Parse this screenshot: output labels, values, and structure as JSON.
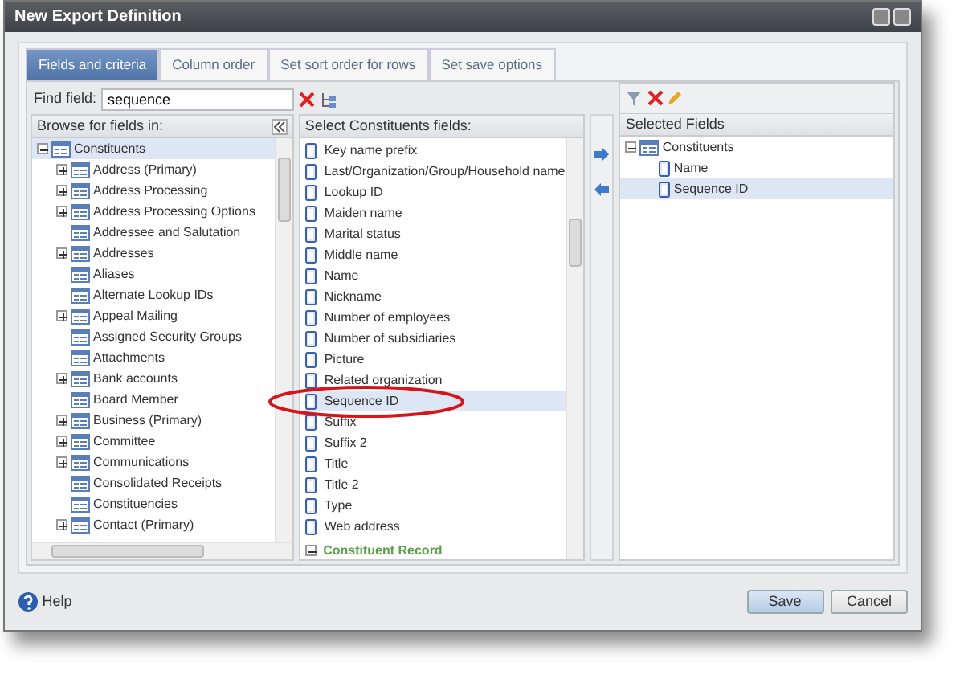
{
  "window": {
    "title": "New Export Definition"
  },
  "tabs": [
    {
      "label": "Fields and criteria",
      "selected": true
    },
    {
      "label": "Column order",
      "selected": false
    },
    {
      "label": "Set sort order for rows",
      "selected": false
    },
    {
      "label": "Set save options",
      "selected": false
    }
  ],
  "find": {
    "label": "Find field:",
    "value": "sequence"
  },
  "browse": {
    "header": "Browse for fields in:",
    "tree": [
      {
        "label": "Constituents",
        "expanded": true,
        "selected": true,
        "children": [
          {
            "label": "Address (Primary)",
            "expanded": false
          },
          {
            "label": "Address Processing",
            "expanded": false
          },
          {
            "label": "Address Processing Options",
            "expanded": false
          },
          {
            "label": "Addressee and Salutation"
          },
          {
            "label": "Addresses",
            "expanded": false
          },
          {
            "label": "Aliases"
          },
          {
            "label": "Alternate Lookup IDs"
          },
          {
            "label": "Appeal Mailing",
            "expanded": false
          },
          {
            "label": "Assigned Security Groups"
          },
          {
            "label": "Attachments"
          },
          {
            "label": "Bank accounts",
            "expanded": false
          },
          {
            "label": "Board Member"
          },
          {
            "label": "Business (Primary)",
            "expanded": false
          },
          {
            "label": "Committee",
            "expanded": false
          },
          {
            "label": "Communications",
            "expanded": false
          },
          {
            "label": "Consolidated Receipts"
          },
          {
            "label": "Constituencies"
          },
          {
            "label": "Contact (Primary)",
            "expanded": false
          }
        ]
      }
    ]
  },
  "fields": {
    "header": "Select Constituents fields:",
    "items": [
      {
        "kind": "field",
        "label": "Key name prefix",
        "selected": false
      },
      {
        "kind": "field",
        "label": "Last/Organization/Group/Household name",
        "selected": false
      },
      {
        "kind": "field",
        "label": "Lookup ID",
        "selected": false
      },
      {
        "kind": "field",
        "label": "Maiden name",
        "selected": false
      },
      {
        "kind": "field",
        "label": "Marital status",
        "selected": false
      },
      {
        "kind": "field",
        "label": "Middle name",
        "selected": false
      },
      {
        "kind": "field",
        "label": "Name",
        "selected": false
      },
      {
        "kind": "field",
        "label": "Nickname",
        "selected": false
      },
      {
        "kind": "field",
        "label": "Number of employees",
        "selected": false
      },
      {
        "kind": "field",
        "label": "Number of subsidiaries",
        "selected": false
      },
      {
        "kind": "field",
        "label": "Picture",
        "selected": false
      },
      {
        "kind": "field",
        "label": "Related organization",
        "selected": false
      },
      {
        "kind": "field",
        "label": "Sequence ID",
        "selected": true
      },
      {
        "kind": "field",
        "label": "Suffix",
        "selected": false
      },
      {
        "kind": "field",
        "label": "Suffix 2",
        "selected": false
      },
      {
        "kind": "field",
        "label": "Title",
        "selected": false
      },
      {
        "kind": "field",
        "label": "Title 2",
        "selected": false
      },
      {
        "kind": "field",
        "label": "Type",
        "selected": false
      },
      {
        "kind": "field",
        "label": "Web address",
        "selected": false
      },
      {
        "kind": "group",
        "label": "Constituent Record",
        "expanded": true
      }
    ]
  },
  "selected_fields": {
    "header": "Selected Fields",
    "tree": [
      {
        "label": "Constituents",
        "expanded": true,
        "selected": false,
        "children": [
          {
            "label": "Name",
            "selected": false
          },
          {
            "label": "Sequence ID",
            "selected": true
          }
        ]
      }
    ]
  },
  "help": "Help",
  "buttons": [
    {
      "label": "Save",
      "kind": "primary"
    },
    {
      "label": "Cancel",
      "kind": "secondary"
    }
  ]
}
